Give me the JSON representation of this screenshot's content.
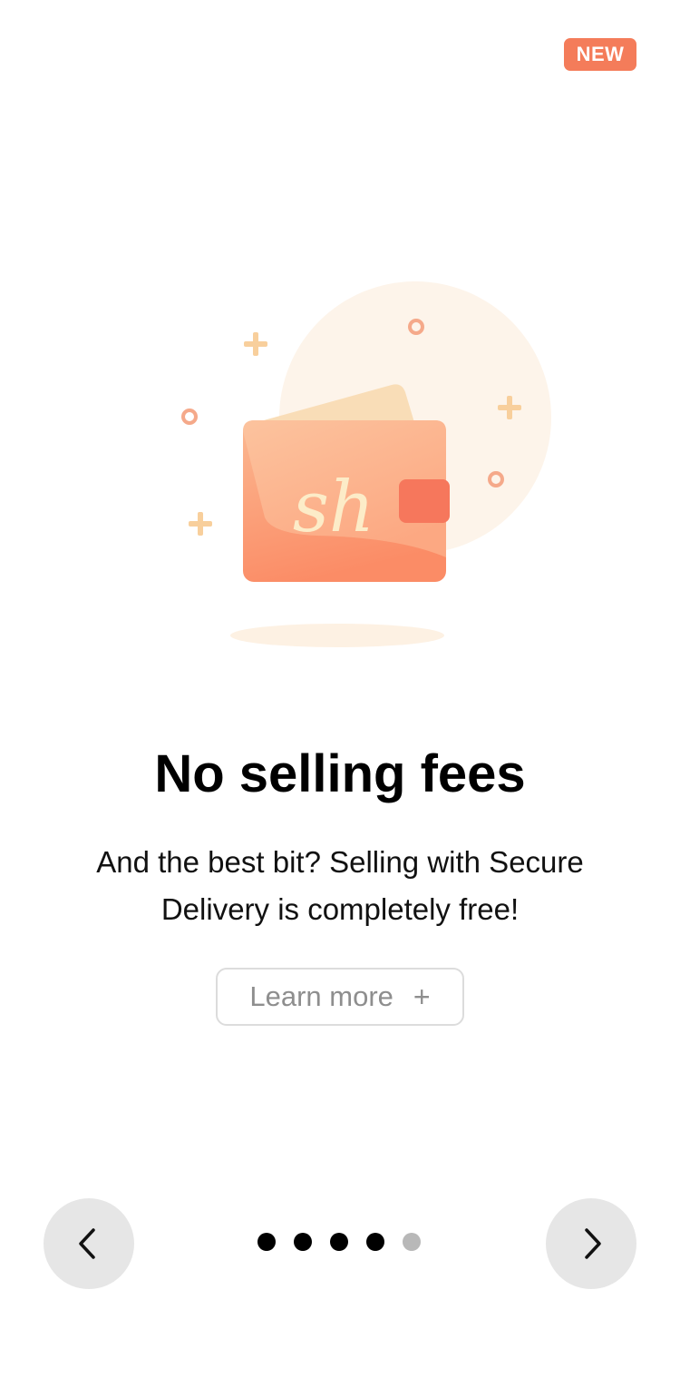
{
  "badge": {
    "label": "NEW"
  },
  "illustration": {
    "monogram": "sh",
    "icon": "wallet-icon"
  },
  "content": {
    "title": "No selling fees",
    "body": "And the best bit? Selling with Secure Delivery is completely free!",
    "learn_more_label": "Learn more",
    "learn_more_icon": "+"
  },
  "pager": {
    "total": 5,
    "active_count": 4,
    "prev_icon": "chevron-left-icon",
    "next_icon": "chevron-right-icon"
  },
  "colors": {
    "accent": "#f47c5a",
    "wallet": "#fa9f78",
    "wallet_light": "#fcc6a0",
    "card": "#f9ddb7",
    "halo": "#fdf4ea",
    "sparkle_orange": "#f5a98a",
    "sparkle_yellow": "#f8cf9c",
    "dot_active": "#000000",
    "dot_inactive": "#b8b8b8"
  }
}
